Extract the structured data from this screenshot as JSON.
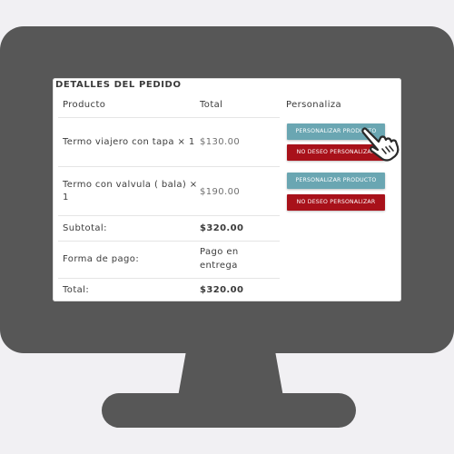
{
  "order": {
    "title": "DETALLES DEL PEDIDO",
    "columns": {
      "product": "Producto",
      "total": "Total",
      "customize": "Personaliza"
    },
    "items": [
      {
        "product_line1": "Termo viajero con tapa × 1",
        "product_line2": "",
        "price": "$130.00",
        "customize_label": "PERSONALIZAR PRODUCTO",
        "decline_label": "NO DESEO PERSONALIZAR"
      },
      {
        "product_line1": "Termo con valvula ( bala) ×",
        "product_line2": "1",
        "price": "$190.00",
        "customize_label": "PERSONALIZAR PRODUCTO",
        "decline_label": "NO DESEO PERSONALIZAR"
      }
    ],
    "subtotal": {
      "label": "Subtotal:",
      "value": "$320.00"
    },
    "payment": {
      "label": "Forma de pago:",
      "value_line1": "Pago en",
      "value_line2": "entrega"
    },
    "total": {
      "label": "Total:",
      "value": "$320.00"
    }
  },
  "colors": {
    "monitor": "#575757",
    "background": "#f1f0f3",
    "customize_button": "#6aa6b2",
    "decline_button": "#a8111a"
  },
  "icons": {
    "cursor": "hand-pointer-icon"
  }
}
